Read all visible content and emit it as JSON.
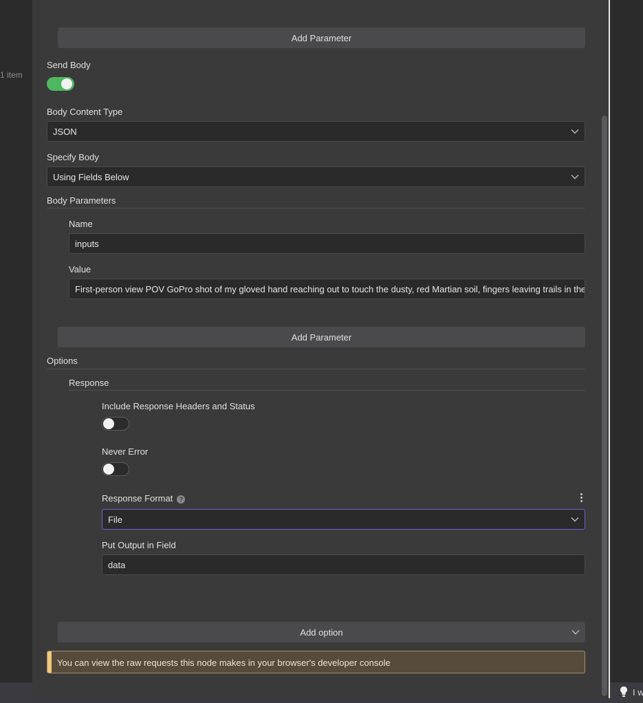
{
  "background": {
    "item_count": "1 item",
    "bottom_tip": "I w"
  },
  "body_params_top": {
    "add_parameter_label": "Add Parameter"
  },
  "send_body": {
    "label": "Send Body",
    "enabled": true
  },
  "body_content_type": {
    "label": "Body Content Type",
    "value": "JSON"
  },
  "specify_body": {
    "label": "Specify Body",
    "value": "Using Fields Below"
  },
  "body_parameters": {
    "title": "Body Parameters",
    "name_label": "Name",
    "name_value": "inputs",
    "value_label": "Value",
    "value_value": "First-person view POV GoPro shot of my gloved hand reaching out to touch the dusty, red Martian soil, fingers leaving trails in the f",
    "add_parameter_label": "Add Parameter"
  },
  "options": {
    "title": "Options",
    "response": {
      "title": "Response",
      "include_headers": {
        "label": "Include Response Headers and Status",
        "enabled": false
      },
      "never_error": {
        "label": "Never Error",
        "enabled": false
      },
      "response_format": {
        "label": "Response Format",
        "help": "?",
        "value": "File"
      },
      "put_output": {
        "label": "Put Output in Field",
        "value": "data"
      }
    },
    "add_option_label": "Add option"
  },
  "notice": {
    "text": "You can view the raw requests this node makes in your browser's developer console"
  },
  "colors": {
    "toggle_on": "#4eb860",
    "focus_border": "#6b63d6",
    "notice_accent": "#f0c87a"
  }
}
